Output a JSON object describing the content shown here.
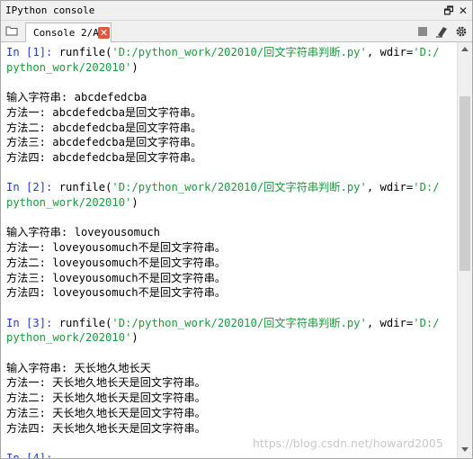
{
  "window": {
    "title": "IPython console"
  },
  "tab": {
    "label": "Console 2/A",
    "close": "✕"
  },
  "titlebar": {
    "restore_glyph": "🗗",
    "close_glyph": "✕"
  },
  "icons": {
    "folder": "folder-icon",
    "stop": "stop-icon",
    "eraser": "eraser-icon",
    "gear": "gear-icon"
  },
  "console": {
    "lines": [
      {
        "parts": [
          {
            "t": "In [",
            "c": "kw"
          },
          {
            "t": "1",
            "c": "kw"
          },
          {
            "t": "]: ",
            "c": "kw"
          },
          {
            "t": "runfile(",
            "c": ""
          },
          {
            "t": "'D:/python_work/202010/回文字符串判断.py'",
            "c": "grn"
          },
          {
            "t": ", wdir=",
            "c": ""
          },
          {
            "t": "'D:/",
            "c": "grn"
          }
        ]
      },
      {
        "parts": [
          {
            "t": "python_work/202010'",
            "c": "grn"
          },
          {
            "t": ")",
            "c": ""
          }
        ]
      },
      {
        "parts": []
      },
      {
        "parts": [
          {
            "t": "输入字符串: abcdefedcba",
            "c": ""
          }
        ]
      },
      {
        "parts": [
          {
            "t": "方法一: abcdefedcba是回文字符串。",
            "c": ""
          }
        ]
      },
      {
        "parts": [
          {
            "t": "方法二: abcdefedcba是回文字符串。",
            "c": ""
          }
        ]
      },
      {
        "parts": [
          {
            "t": "方法三: abcdefedcba是回文字符串。",
            "c": ""
          }
        ]
      },
      {
        "parts": [
          {
            "t": "方法四: abcdefedcba是回文字符串。",
            "c": ""
          }
        ]
      },
      {
        "parts": []
      },
      {
        "parts": [
          {
            "t": "In [",
            "c": "kw"
          },
          {
            "t": "2",
            "c": "kw"
          },
          {
            "t": "]: ",
            "c": "kw"
          },
          {
            "t": "runfile(",
            "c": ""
          },
          {
            "t": "'D:/python_work/202010/回文字符串判断.py'",
            "c": "grn"
          },
          {
            "t": ", wdir=",
            "c": ""
          },
          {
            "t": "'D:/",
            "c": "grn"
          }
        ]
      },
      {
        "parts": [
          {
            "t": "python_work/202010'",
            "c": "grn"
          },
          {
            "t": ")",
            "c": ""
          }
        ]
      },
      {
        "parts": []
      },
      {
        "parts": [
          {
            "t": "输入字符串: loveyousomuch",
            "c": ""
          }
        ]
      },
      {
        "parts": [
          {
            "t": "方法一: loveyousomuch不是回文字符串。",
            "c": ""
          }
        ]
      },
      {
        "parts": [
          {
            "t": "方法二: loveyousomuch不是回文字符串。",
            "c": ""
          }
        ]
      },
      {
        "parts": [
          {
            "t": "方法三: loveyousomuch不是回文字符串。",
            "c": ""
          }
        ]
      },
      {
        "parts": [
          {
            "t": "方法四: loveyousomuch不是回文字符串。",
            "c": ""
          }
        ]
      },
      {
        "parts": []
      },
      {
        "parts": [
          {
            "t": "In [",
            "c": "kw"
          },
          {
            "t": "3",
            "c": "kw"
          },
          {
            "t": "]: ",
            "c": "kw"
          },
          {
            "t": "runfile(",
            "c": ""
          },
          {
            "t": "'D:/python_work/202010/回文字符串判断.py'",
            "c": "grn"
          },
          {
            "t": ", wdir=",
            "c": ""
          },
          {
            "t": "'D:/",
            "c": "grn"
          }
        ]
      },
      {
        "parts": [
          {
            "t": "python_work/202010'",
            "c": "grn"
          },
          {
            "t": ")",
            "c": ""
          }
        ]
      },
      {
        "parts": []
      },
      {
        "parts": [
          {
            "t": "输入字符串: 天长地久地长天",
            "c": ""
          }
        ]
      },
      {
        "parts": [
          {
            "t": "方法一: 天长地久地长天是回文字符串。",
            "c": ""
          }
        ]
      },
      {
        "parts": [
          {
            "t": "方法二: 天长地久地长天是回文字符串。",
            "c": ""
          }
        ]
      },
      {
        "parts": [
          {
            "t": "方法三: 天长地久地长天是回文字符串。",
            "c": ""
          }
        ]
      },
      {
        "parts": [
          {
            "t": "方法四: 天长地久地长天是回文字符串。",
            "c": ""
          }
        ]
      },
      {
        "parts": []
      },
      {
        "parts": [
          {
            "t": "In [",
            "c": "kw"
          },
          {
            "t": "4",
            "c": "kw"
          },
          {
            "t": "]:",
            "c": "kw"
          }
        ]
      }
    ]
  },
  "watermark": "https://blog.csdn.net/howard2005"
}
